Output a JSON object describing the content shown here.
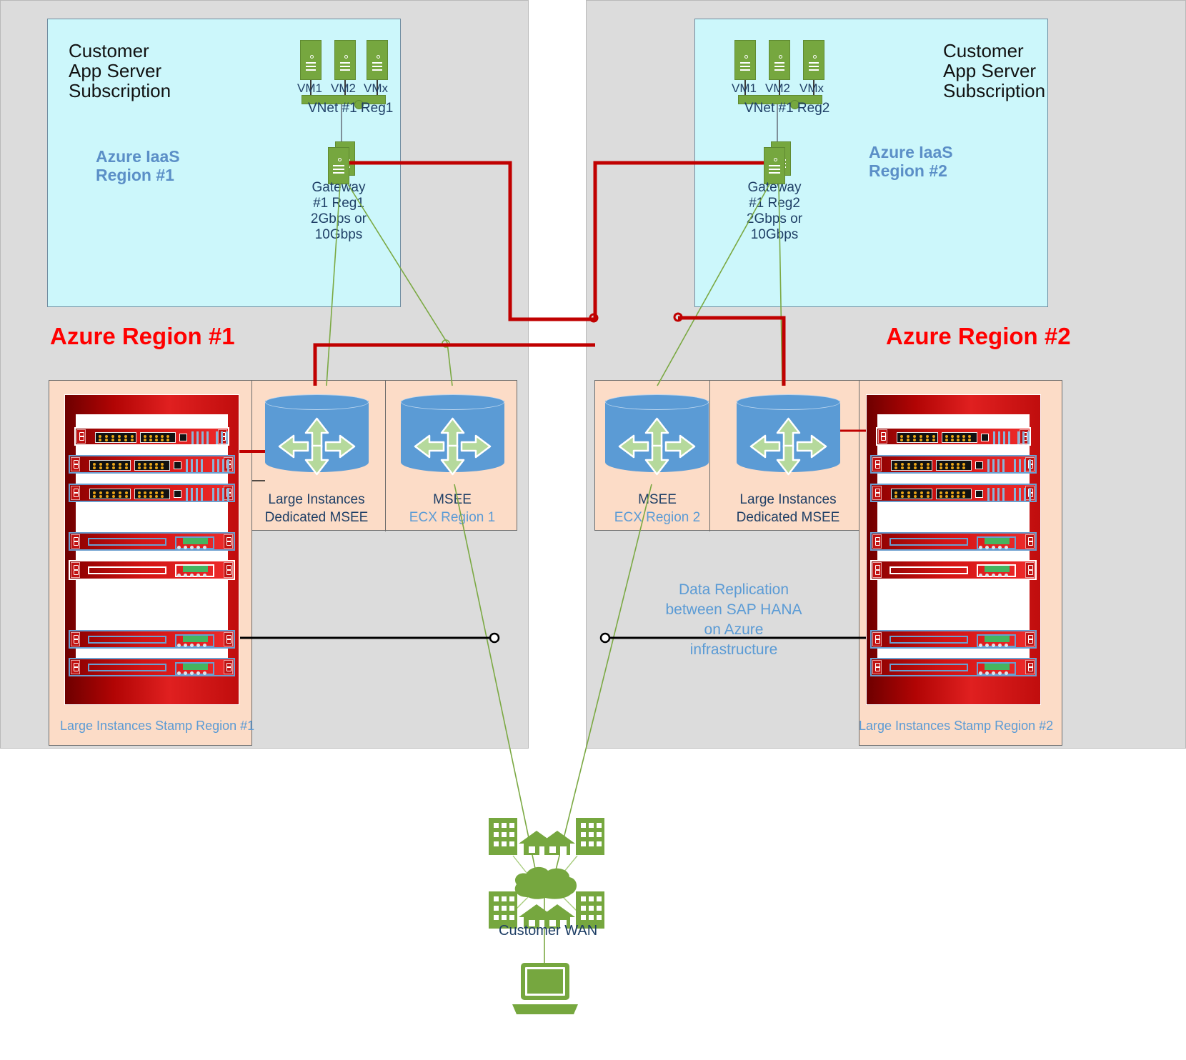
{
  "diagram": {
    "title": "SAP HANA Large Instances multi-region architecture",
    "colors": {
      "region_panel": "#dcdcdc",
      "subscription_box": "#ccf7fb",
      "ecx_box": "#fcdcc7",
      "accent_blue": "#5b9bd5",
      "accent_red": "#ff0000",
      "express_route_red": "#c00000",
      "green": "#76a73f",
      "dark_blue_text": "#1f3f66"
    }
  },
  "regions": [
    {
      "id": "region1",
      "heading": "Azure Region #1",
      "subscription": {
        "title": "Customer\nApp Server\nSubscription",
        "iaas_label": "Azure IaaS\nRegion #1",
        "vms": [
          "VM1",
          "VM2",
          "VMx"
        ],
        "vnet_label": "VNet #1 Reg1",
        "gateway_label": "Gateway\n#1 Reg1\n2Gbps or\n10Gbps"
      },
      "ecx": {
        "nodes": [
          {
            "line1": "Large Instances",
            "line2": "Dedicated MSEE",
            "line2_blue": false
          },
          {
            "line1": "MSEE",
            "line2": "ECX Region 1",
            "line2_blue": true
          }
        ]
      },
      "stamp_label": "Large Instances Stamp Region #1"
    },
    {
      "id": "region2",
      "heading": "Azure Region #2",
      "subscription": {
        "title": "Customer\nApp Server\nSubscription",
        "iaas_label": "Azure IaaS\nRegion #2",
        "vms": [
          "VM1",
          "VM2",
          "VMx"
        ],
        "vnet_label": "VNet #1 Reg2",
        "gateway_label": "Gateway\n#1 Reg2\n2Gbps or\n10Gbps"
      },
      "ecx": {
        "nodes": [
          {
            "line1": "MSEE",
            "line2": "ECX Region 2",
            "line2_blue": true
          },
          {
            "line1": "Large Instances",
            "line2": "Dedicated MSEE",
            "line2_blue": false
          }
        ]
      },
      "stamp_label": "Large Instances Stamp Region #2"
    }
  ],
  "replication": {
    "text": "Data Replication\nbetween SAP HANA\non Azure\ninfrastructure"
  },
  "wan": {
    "label": "Customer WAN",
    "icons": [
      "building-icon",
      "house-icon",
      "house-icon",
      "building-icon",
      "cloud-icon",
      "building-icon",
      "house-icon",
      "house-icon",
      "building-icon",
      "laptop-icon"
    ]
  },
  "icon_names": {
    "vm": "virtual-machine-icon",
    "gateway": "gateway-icon",
    "router": "router-icon",
    "rack": "server-rack-icon",
    "cloud": "cloud-icon",
    "laptop": "laptop-icon",
    "building": "building-icon",
    "house": "house-icon",
    "vnet": "vnet-bar-icon"
  }
}
